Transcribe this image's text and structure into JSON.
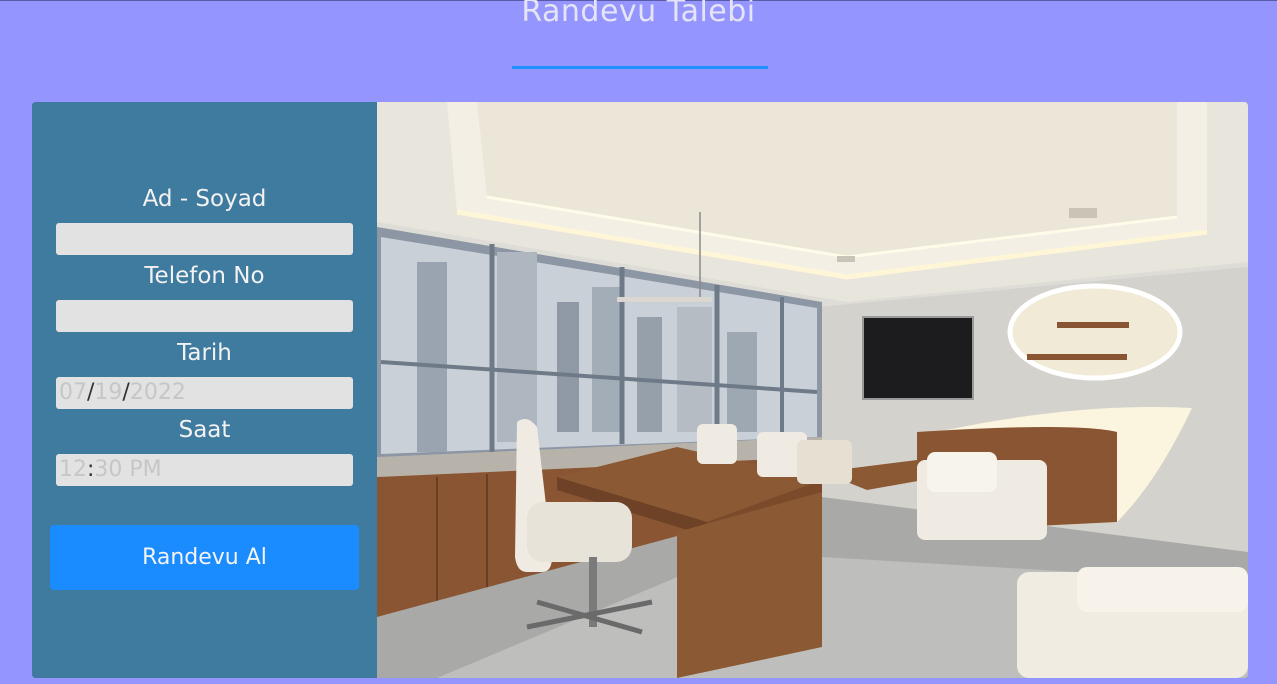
{
  "header": {
    "title": "Randevu Talebi"
  },
  "form": {
    "name_label": "Ad - Soyad",
    "name_value": "",
    "phone_label": "Telefon No",
    "phone_value": "",
    "date_label": "Tarih",
    "date_month": "07",
    "date_day": "19",
    "date_year": "2022",
    "date_sep": "/",
    "time_label": "Saat",
    "time_hour": "12",
    "time_sep": ":",
    "time_rest": "30 PM",
    "submit_label": "Randevu Al"
  },
  "colors": {
    "background": "#9595ff",
    "panel": "#3f7a9f",
    "accent": "#1a8cff",
    "input": "#e2e2e2"
  }
}
